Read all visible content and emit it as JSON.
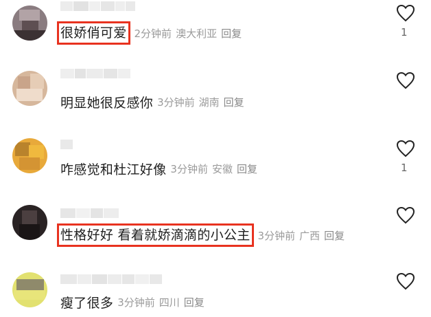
{
  "comments": [
    {
      "text": "很娇俏可爱",
      "time": "2分钟前",
      "location": "澳大利亚",
      "reply": "回复",
      "likes": "1",
      "highlighted": true
    },
    {
      "text": "明显她很反感你",
      "time": "3分钟前",
      "location": "湖南",
      "reply": "回复",
      "likes": "",
      "highlighted": false
    },
    {
      "text": "咋感觉和杜江好像",
      "time": "3分钟前",
      "location": "安徽",
      "reply": "回复",
      "likes": "1",
      "highlighted": false
    },
    {
      "text": "性格好好 看着就娇滴滴的小公主",
      "time": "3分钟前",
      "location": "广西",
      "reply": "回复",
      "likes": "",
      "highlighted": true
    },
    {
      "text": "瘦了很多",
      "time": "3分钟前",
      "location": "四川",
      "reply": "回复",
      "likes": "",
      "highlighted": false
    }
  ],
  "icons": {
    "like": "heart-outline-icon"
  },
  "colors": {
    "highlight": "#e8321f",
    "meta": "#9a9a9a",
    "text": "#1f1f1f"
  }
}
